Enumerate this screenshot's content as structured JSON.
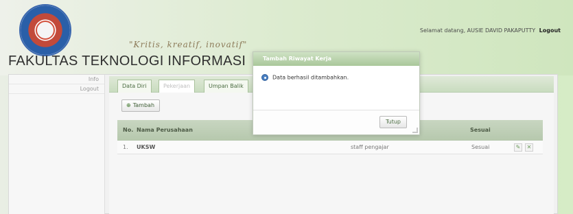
{
  "header": {
    "faculty_title": "FAKULTAS TEKNOLOGI INFORMASI",
    "tagline": "\"Kritis, kreatif, inovatif\"",
    "welcome_text": "Selamat datang, AUSIE DAVID PAKAPUTTY",
    "logout_label": "Logout"
  },
  "sidenav": {
    "items": [
      {
        "label": "Info"
      },
      {
        "label": "Logout"
      }
    ]
  },
  "tabs": [
    {
      "label": "Data Diri",
      "active": false
    },
    {
      "label": "Pekerjaan",
      "active": true
    },
    {
      "label": "Umpan Balik",
      "active": false
    }
  ],
  "panel": {
    "add_button_label": "Tambah"
  },
  "table": {
    "headers": {
      "no": "No.",
      "company": "Nama Perusahaan",
      "match": "Sesuai"
    },
    "rows": [
      {
        "no": "1.",
        "company": "UKSW",
        "position": "staff pengajar",
        "match": "Sesuai"
      }
    ]
  },
  "dialog": {
    "title": "Tambah Riwayat Kerja",
    "message": "Data berhasil ditambahkan.",
    "close_label": "Tutup"
  },
  "colors": {
    "accent_green": "#a9c79a",
    "header_green": "#cfe6be",
    "info_blue": "#4a7fc1"
  },
  "icons": {
    "add": "plus-icon",
    "info": "info-icon",
    "edit": "edit-icon",
    "delete": "delete-icon"
  }
}
